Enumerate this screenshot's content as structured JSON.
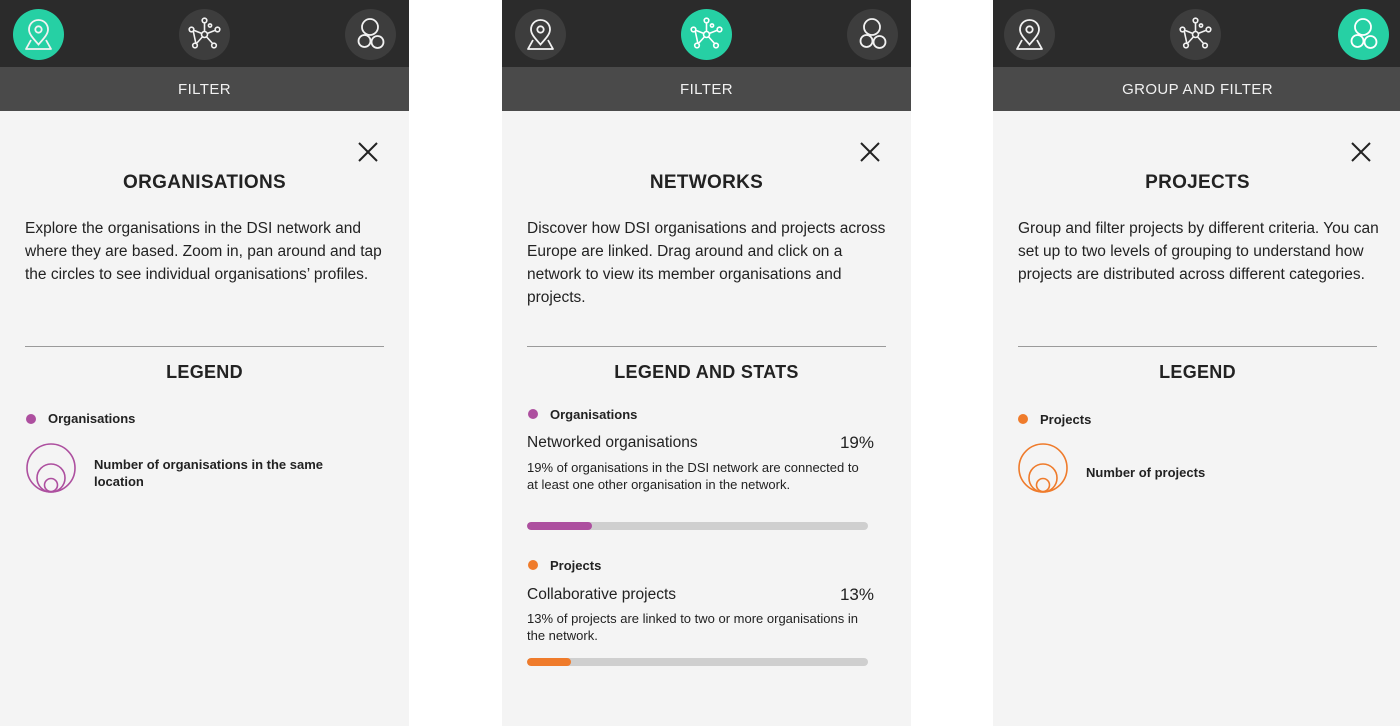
{
  "panels": [
    {
      "subbar": "FILTER",
      "title": "ORGANISATIONS",
      "description": "Explore the organisations in the DSI network and where they are based. Zoom in, pan around and tap the circles to see individual organisations’ profiles.",
      "legend_title": "LEGEND",
      "legend": {
        "dot_label": "Organisations",
        "circle_label": "Number of organisations in the same location"
      }
    },
    {
      "subbar": "FILTER",
      "title": "NETWORKS",
      "description": "Discover how DSI organisations and projects across Europe are linked. Drag around and click on a network to view its member organisations and projects.",
      "legend_title": "LEGEND AND STATS",
      "stats": [
        {
          "dot_label": "Organisations",
          "label": "Networked organisations",
          "percent_text": "19%",
          "value": 0.19,
          "description": "19% of organisations in the DSI network are connected to at least one other organisation in the network."
        },
        {
          "dot_label": "Projects",
          "label": "Collaborative projects",
          "percent_text": "13%",
          "value": 0.13,
          "description": "13% of projects are linked to two or more organisations in the network."
        }
      ]
    },
    {
      "subbar": "GROUP AND FILTER",
      "title": "PROJECTS",
      "description": "Group and filter projects by different criteria. You can set up to two levels of grouping to understand how projects are distributed across different categories.",
      "legend_title": "LEGEND",
      "legend": {
        "dot_label": "Projects",
        "circle_label": "Number of projects"
      }
    }
  ],
  "tabs": [
    {
      "icon": "map-pin-icon"
    },
    {
      "icon": "network-icon"
    },
    {
      "icon": "circles-group-icon"
    }
  ],
  "active_tab_per_panel": [
    0,
    1,
    2
  ],
  "colors": {
    "accent": "#26d0a4",
    "organisations": "#ad4f9f",
    "projects": "#ef7b2b",
    "topbar": "#2b2b2b",
    "subbar": "#4a4a4a",
    "panel_bg": "#f4f4f4"
  }
}
